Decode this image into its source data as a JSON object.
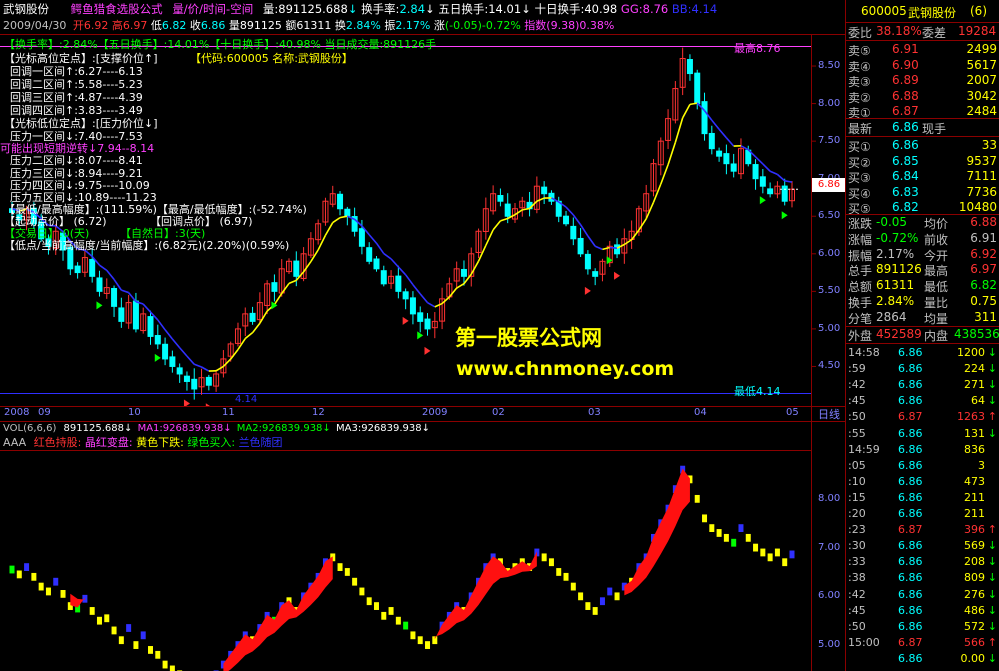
{
  "title": {
    "stock": "武钢股份",
    "formula": "鳄鱼猎食选股公式",
    "mode": "量/价/时间-空间",
    "vol_label": "量:",
    "vol_value": "891125.688",
    "turn_label": "换手率:",
    "turn_value": "2.84",
    "turn5_label": "五日换手:",
    "turn5_value": "14.01",
    "turn10_label": "十日换手:",
    "turn10_value": "40.98",
    "gg_label": "GG:",
    "gg_value": "8.76",
    "bb_label": "BB:",
    "bb_value": "4.14"
  },
  "ohlc": {
    "date": "2009/04/30",
    "open_label": "开",
    "open": "6.92",
    "high_label": "高",
    "high": "6.97",
    "low_label": "低",
    "low": "6.82",
    "close_label": "收",
    "close": "6.86",
    "volume_label": "量",
    "volume": "891125",
    "amount_label": "额",
    "amount": "61311",
    "turn_label": "换",
    "turn": "2.84%",
    "amp_label": "振",
    "amp": "2.17%",
    "chg_label": "涨",
    "chg": "(-0.05)-0.72%",
    "index_label": "指数",
    "index": "(9.38)0.38%"
  },
  "overlay": {
    "line1": "【换手率】:2.84%【五日换手】:14.01%【十日换手】:40.98% 当日成交量:891126手",
    "support_title": "【光标高位定点】:[支撑价位↑]",
    "code": "【代码:600005 名称:武钢股份】",
    "support_rows": [
      "回调一区间↑:6.27----6.13",
      "回调二区间↑:5.58----5.23",
      "回调三区间↑:4.87----4.39",
      "回调四区间↑:3.83----3.49"
    ],
    "pressure_title": "【光标低位定点】:[压力价位↓]",
    "pressure_rows": [
      "压力一区间↓:7.40----7.53",
      "压力二区间↓:8.07----8.41",
      "压力三区间↓:8.94----9.21",
      "压力四区间↓:9.75----10.09",
      "压力五区间↓:10.89----11.23"
    ],
    "reversal": "可能出现短期逆转↓7.94--8.14",
    "amplitude": "【最低/最高幅度】:(111.59%)【最高/最低幅度】:(-52.74%)",
    "start_point": "【起动点价】 (6.72)",
    "pullback": "【回调点价】 (6.97)",
    "trade_days": "【交易日】:0(天)",
    "natural_days": "【自然日】:3(天)",
    "low_high": "【低点/当前高幅度/当前幅度】:(6.82元)(2.20%)(0.59%)"
  },
  "annotations": {
    "top": "最高8.76",
    "bottom": "最低4.14",
    "low_mark": "4.14",
    "current": "6.86"
  },
  "watermark": {
    "line1": "第一股票公式网",
    "line2": "www.chnmoney.com"
  },
  "price_axis": [
    "8.50",
    "8.00",
    "7.50",
    "7.00",
    "6.50",
    "6.00",
    "5.50",
    "5.00",
    "4.50"
  ],
  "date_axis": [
    "2008",
    "09",
    "10",
    "11",
    "12",
    "2009",
    "02",
    "03",
    "04",
    "05"
  ],
  "date_tab": "日线",
  "vol_header": {
    "name": "VOL(6,6,6)",
    "v1": "891125.688↓",
    "ma1": "MA1:926839.938↓",
    "ma2": "MA2:926839.938↓",
    "ma3": "MA3:926839.938↓"
  },
  "indicator_legend": {
    "name": "AAA",
    "red": "红色持股:",
    "red2": "晶红变盘:",
    "yellow": "黄色下跌:",
    "green": "绿色买入:",
    "blue": "兰色随团"
  },
  "sub_axis": [
    "8.00",
    "7.00",
    "6.00",
    "5.00"
  ],
  "panel": {
    "code": "600005",
    "name": "武钢股份",
    "badge": "(6)",
    "ratio_label": "委比",
    "ratio": "38.18%",
    "diff_label": "委差",
    "diff": "19284",
    "asks": [
      {
        "label": "卖⑤",
        "price": "6.91",
        "vol": "2499"
      },
      {
        "label": "卖④",
        "price": "6.90",
        "vol": "5617"
      },
      {
        "label": "卖③",
        "price": "6.89",
        "vol": "2007"
      },
      {
        "label": "卖②",
        "price": "6.88",
        "vol": "3042"
      },
      {
        "label": "卖①",
        "price": "6.87",
        "vol": "2484"
      }
    ],
    "last_label": "最新",
    "last": "6.86",
    "vol_now_label": "现手",
    "bids": [
      {
        "label": "买①",
        "price": "6.86",
        "vol": "33"
      },
      {
        "label": "买②",
        "price": "6.85",
        "vol": "9537"
      },
      {
        "label": "买③",
        "price": "6.84",
        "vol": "7111"
      },
      {
        "label": "买④",
        "price": "6.83",
        "vol": "7736"
      },
      {
        "label": "买⑤",
        "price": "6.82",
        "vol": "10480"
      }
    ],
    "stats": [
      {
        "l1": "涨跌",
        "v1": "-0.05",
        "l2": "均价",
        "v2": "6.88"
      },
      {
        "l1": "涨幅",
        "v1": "-0.72%",
        "l2": "前收",
        "v2": "6.91"
      },
      {
        "l1": "振幅",
        "v1": "2.17%",
        "l2": "今开",
        "v2": "6.92"
      },
      {
        "l1": "总手",
        "v1": "891126",
        "l2": "最高",
        "v2": "6.97"
      },
      {
        "l1": "总额",
        "v1": "61311",
        "l2": "最低",
        "v2": "6.82"
      },
      {
        "l1": "换手",
        "v1": "2.84%",
        "l2": "量比",
        "v2": "0.75"
      },
      {
        "l1": "分笔",
        "v1": "2864",
        "l2": "均量",
        "v2": "311"
      }
    ],
    "outer_label": "外盘",
    "outer": "452589",
    "inner_label": "内盘",
    "inner": "438536",
    "ticks": [
      {
        "t": "14:58",
        "p": "6.86",
        "v": "1200",
        "d": "↓"
      },
      {
        "t": ":59",
        "p": "6.86",
        "v": "224",
        "d": "↓"
      },
      {
        "t": ":42",
        "p": "6.86",
        "v": "271",
        "d": "↓"
      },
      {
        "t": ":45",
        "p": "6.86",
        "v": "64",
        "d": "↓"
      },
      {
        "t": ":50",
        "p": "6.87",
        "v": "1263",
        "d": "↑"
      },
      {
        "t": ":55",
        "p": "6.86",
        "v": "131",
        "d": "↓"
      },
      {
        "t": "14:59",
        "p": "6.86",
        "v": "836",
        "d": ""
      },
      {
        "t": ":05",
        "p": "6.86",
        "v": "3",
        "d": ""
      },
      {
        "t": ":10",
        "p": "6.86",
        "v": "473",
        "d": ""
      },
      {
        "t": ":15",
        "p": "6.86",
        "v": "211",
        "d": ""
      },
      {
        "t": ":20",
        "p": "6.86",
        "v": "211",
        "d": ""
      },
      {
        "t": ":23",
        "p": "6.87",
        "v": "396",
        "d": "↑"
      },
      {
        "t": ":30",
        "p": "6.86",
        "v": "569",
        "d": "↓"
      },
      {
        "t": ":33",
        "p": "6.86",
        "v": "208",
        "d": "↓"
      },
      {
        "t": ":38",
        "p": "6.86",
        "v": "809",
        "d": "↓"
      },
      {
        "t": ":42",
        "p": "6.86",
        "v": "276",
        "d": "↓"
      },
      {
        "t": ":45",
        "p": "6.86",
        "v": "486",
        "d": "↓"
      },
      {
        "t": ":50",
        "p": "6.86",
        "v": "572",
        "d": "↓"
      },
      {
        "t": "15:00",
        "p": "6.87",
        "v": "566",
        "d": "↑"
      },
      {
        "t": "",
        "p": "6.86",
        "v": "0.00",
        "d": "↓"
      }
    ]
  },
  "colors": {
    "up": "#ff3232",
    "down": "#00ffff",
    "yellow": "#ffff00",
    "blue": "#3030ff",
    "green": "#00ff00",
    "magenta": "#ff40ff",
    "frame": "#8b0000"
  },
  "chart_data": {
    "type": "candlestick",
    "period": "daily",
    "start": "2008 (month 08)",
    "end": "2009/04/30",
    "ylim": [
      4.0,
      8.9
    ],
    "highest": 8.76,
    "lowest": 4.14,
    "closes": [
      6.55,
      6.45,
      6.6,
      6.4,
      6.2,
      6.1,
      6.3,
      6.05,
      5.8,
      5.75,
      5.95,
      5.7,
      5.5,
      5.55,
      5.3,
      5.1,
      5.35,
      5.0,
      5.2,
      4.9,
      4.8,
      4.6,
      4.5,
      4.4,
      4.3,
      4.2,
      4.35,
      4.25,
      4.4,
      4.6,
      4.8,
      5.0,
      5.2,
      5.1,
      5.35,
      5.6,
      5.5,
      5.8,
      5.9,
      5.7,
      6.0,
      6.2,
      6.4,
      6.7,
      6.8,
      6.6,
      6.5,
      6.3,
      6.1,
      5.9,
      5.8,
      5.6,
      5.7,
      5.5,
      5.4,
      5.2,
      5.1,
      5.0,
      5.1,
      5.4,
      5.6,
      5.8,
      5.7,
      6.0,
      6.3,
      6.6,
      6.8,
      6.7,
      6.5,
      6.6,
      6.7,
      6.6,
      6.9,
      6.8,
      6.7,
      6.5,
      6.4,
      6.2,
      6.0,
      5.8,
      5.7,
      5.9,
      6.1,
      6.0,
      6.2,
      6.3,
      6.6,
      6.8,
      7.2,
      7.5,
      7.8,
      8.2,
      8.6,
      8.4,
      8.0,
      7.6,
      7.4,
      7.3,
      7.2,
      7.1,
      7.4,
      7.2,
      7.0,
      6.9,
      6.8,
      6.9,
      6.7,
      6.86
    ]
  }
}
